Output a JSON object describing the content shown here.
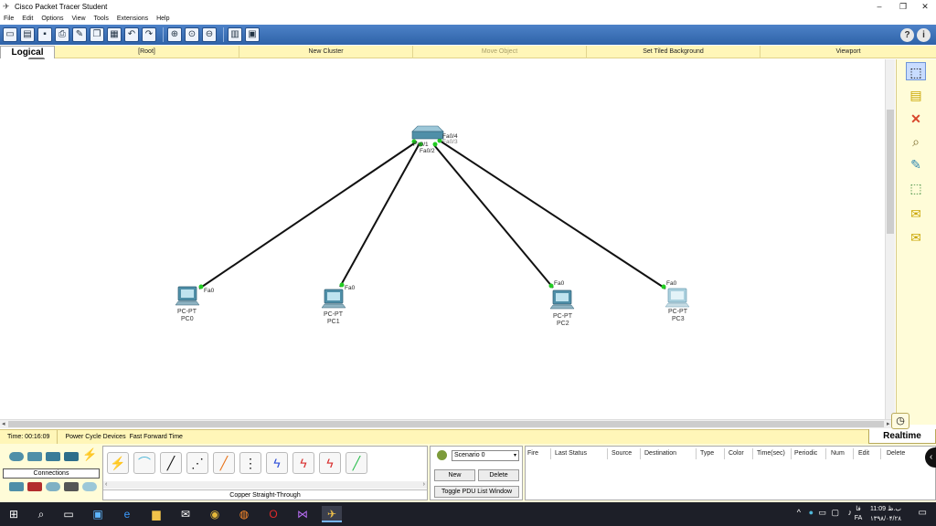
{
  "window": {
    "title": "Cisco Packet Tracer Student",
    "minimize": "–",
    "maximize": "❐",
    "close": "✕"
  },
  "menu": [
    "File",
    "Edit",
    "Options",
    "View",
    "Tools",
    "Extensions",
    "Help"
  ],
  "toolbar": {
    "icons": [
      "new-icon",
      "open-icon",
      "save-icon",
      "print-icon",
      "activity-wizard-icon",
      "copy-icon",
      "paste-icon",
      "undo-icon",
      "redo-icon",
      "zoom-in-icon",
      "zoom-reset-icon",
      "zoom-out-icon",
      "palette-icon",
      "custom-device-icon"
    ],
    "help": "?",
    "info": "i"
  },
  "logical_bar": {
    "tab": "Logical",
    "root": "[Root]",
    "new_cluster": "New Cluster",
    "move_object": "Move Object",
    "set_tiled_background": "Set Tiled Background",
    "viewport": "Viewport"
  },
  "topology": {
    "switch": {
      "ports": [
        "Fa0/4",
        "Fa0/3",
        "Fa0/1",
        "Fa0/2"
      ]
    },
    "pcs": [
      {
        "model": "PC-PT",
        "name": "PC0",
        "port": "Fa0"
      },
      {
        "model": "PC-PT",
        "name": "PC1",
        "port": "Fa0"
      },
      {
        "model": "PC-PT",
        "name": "PC2",
        "port": "Fa0"
      },
      {
        "model": "PC-PT",
        "name": "PC3",
        "port": "Fa0"
      }
    ],
    "link_color": "#111111",
    "link_up_color": "#22cc22"
  },
  "status": {
    "time": "Time: 00:16:09",
    "power_cycle": "Power Cycle Devices",
    "fast_forward": "Fast Forward Time",
    "realtime": "Realtime"
  },
  "device_panel": {
    "category_label": "Connections",
    "cable_selected_label": "Copper Straight-Through"
  },
  "scenario": {
    "selected": "Scenario 0",
    "new": "New",
    "delete": "Delete",
    "toggle": "Toggle PDU List Window"
  },
  "pdu_table": {
    "headers": [
      "Fire",
      "Last Status",
      "Source",
      "Destination",
      "Type",
      "Color",
      "Time(sec)",
      "Periodic",
      "Num",
      "Edit",
      "Delete"
    ]
  },
  "taskbar": {
    "lang": "FA",
    "lang_top": "فا",
    "time": "11:09 ب.ظ",
    "date": "۱۳۹۸/۰۴/۲۸"
  }
}
